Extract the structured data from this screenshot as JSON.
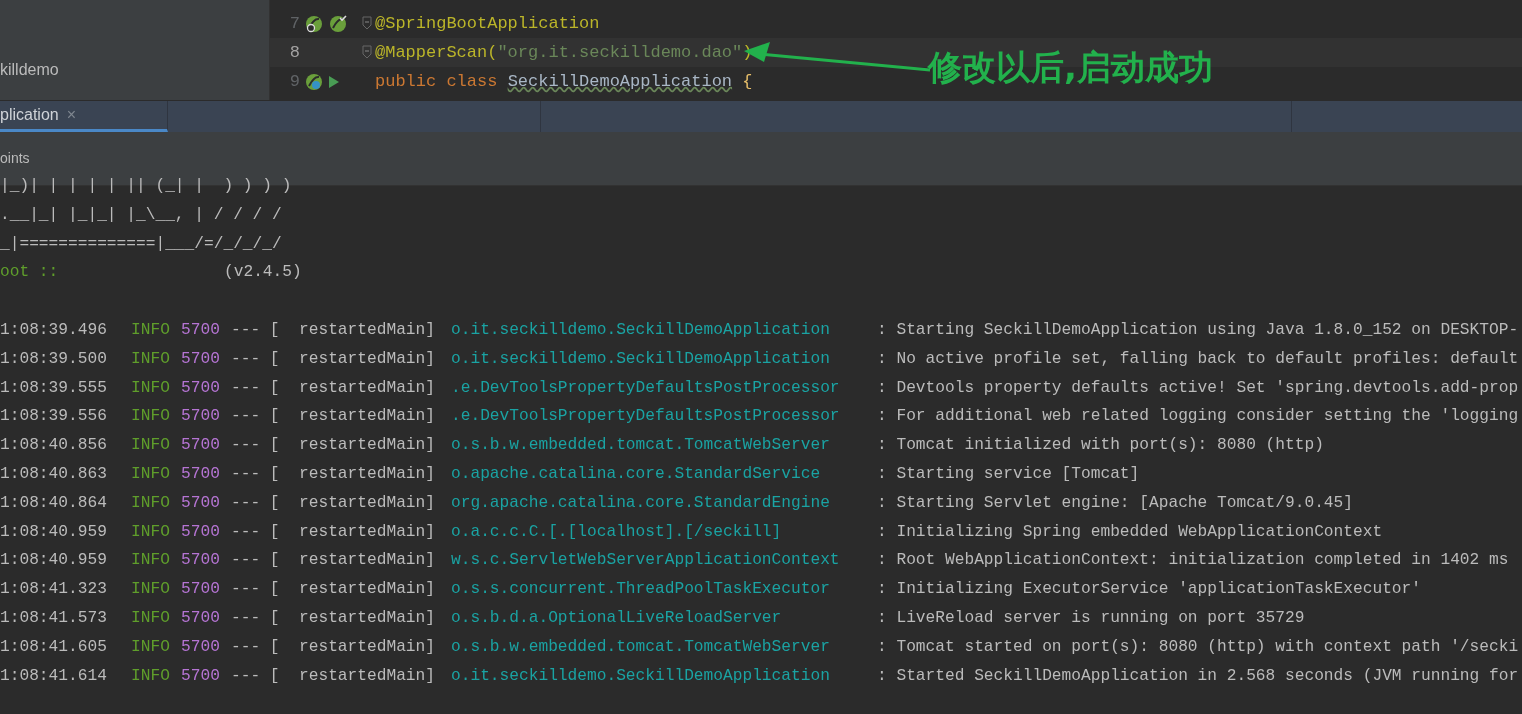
{
  "project_panel": {
    "item": "killdemo"
  },
  "editor": {
    "lines": [
      {
        "number": "7",
        "current": false,
        "kind": "bean",
        "fold": true,
        "tokens": [
          {
            "kind": "annotation",
            "text": "@SpringBootApplication"
          }
        ]
      },
      {
        "number": "8",
        "current": true,
        "kind": "plain",
        "fold": true,
        "tokens": [
          {
            "kind": "annotation",
            "text": "@MapperScan("
          },
          {
            "kind": "string",
            "text": "\"org.it.seckilldemo.dao\""
          },
          {
            "kind": "annotation",
            "text": ")"
          }
        ]
      },
      {
        "number": "9",
        "current": false,
        "kind": "run",
        "fold": false,
        "tokens": [
          {
            "kind": "keyword",
            "text": "public class "
          },
          {
            "kind": "typo",
            "text": "SeckillDemoApplication"
          },
          {
            "kind": "brace",
            "text": " {"
          }
        ]
      }
    ]
  },
  "annotation": {
    "text": "修改以后,启动成功"
  },
  "run_tabs": [
    {
      "label": "plication",
      "selected": true,
      "close": "×"
    }
  ],
  "toolbar": {
    "label": "oints"
  },
  "console": {
    "banner": [
      {
        "kind": "art",
        "text": "|_)| | | | | || (_| |  ) ) ) )"
      },
      {
        "kind": "art",
        "text": ".__|_| |_|_| |_\\__, | / / / /"
      },
      {
        "kind": "art",
        "text": "_|==============|___/=/_/_/_/"
      },
      {
        "kind": "boot",
        "text": "oot ::",
        "version": "(v2.4.5)"
      }
    ],
    "rows": [
      {
        "time": "1:08:39.496",
        "level": "INFO",
        "pid": "5700",
        "thread": "--- [  restartedMain]",
        "logger": "o.it.seckilldemo.SeckillDemoApplication",
        "message": ": Starting SeckillDemoApplication using Java 1.8.0_152 on DESKTOP-"
      },
      {
        "time": "1:08:39.500",
        "level": "INFO",
        "pid": "5700",
        "thread": "--- [  restartedMain]",
        "logger": "o.it.seckilldemo.SeckillDemoApplication",
        "message": ": No active profile set, falling back to default profiles: default"
      },
      {
        "time": "1:08:39.555",
        "level": "INFO",
        "pid": "5700",
        "thread": "--- [  restartedMain]",
        "logger": ".e.DevToolsPropertyDefaultsPostProcessor",
        "message": ": Devtools property defaults active! Set 'spring.devtools.add-prop"
      },
      {
        "time": "1:08:39.556",
        "level": "INFO",
        "pid": "5700",
        "thread": "--- [  restartedMain]",
        "logger": ".e.DevToolsPropertyDefaultsPostProcessor",
        "message": ": For additional web related logging consider setting the 'logging"
      },
      {
        "time": "1:08:40.856",
        "level": "INFO",
        "pid": "5700",
        "thread": "--- [  restartedMain]",
        "logger": "o.s.b.w.embedded.tomcat.TomcatWebServer",
        "message": ": Tomcat initialized with port(s): 8080 (http)"
      },
      {
        "time": "1:08:40.863",
        "level": "INFO",
        "pid": "5700",
        "thread": "--- [  restartedMain]",
        "logger": "o.apache.catalina.core.StandardService",
        "message": ": Starting service [Tomcat]"
      },
      {
        "time": "1:08:40.864",
        "level": "INFO",
        "pid": "5700",
        "thread": "--- [  restartedMain]",
        "logger": "org.apache.catalina.core.StandardEngine",
        "message": ": Starting Servlet engine: [Apache Tomcat/9.0.45]"
      },
      {
        "time": "1:08:40.959",
        "level": "INFO",
        "pid": "5700",
        "thread": "--- [  restartedMain]",
        "logger": "o.a.c.c.C.[.[localhost].[/seckill]",
        "message": ": Initializing Spring embedded WebApplicationContext"
      },
      {
        "time": "1:08:40.959",
        "level": "INFO",
        "pid": "5700",
        "thread": "--- [  restartedMain]",
        "logger": "w.s.c.ServletWebServerApplicationContext",
        "message": ": Root WebApplicationContext: initialization completed in 1402 ms"
      },
      {
        "time": "1:08:41.323",
        "level": "INFO",
        "pid": "5700",
        "thread": "--- [  restartedMain]",
        "logger": "o.s.s.concurrent.ThreadPoolTaskExecutor",
        "message": ": Initializing ExecutorService 'applicationTaskExecutor'"
      },
      {
        "time": "1:08:41.573",
        "level": "INFO",
        "pid": "5700",
        "thread": "--- [  restartedMain]",
        "logger": "o.s.b.d.a.OptionalLiveReloadServer",
        "message": ": LiveReload server is running on port 35729"
      },
      {
        "time": "1:08:41.605",
        "level": "INFO",
        "pid": "5700",
        "thread": "--- [  restartedMain]",
        "logger": "o.s.b.w.embedded.tomcat.TomcatWebServer",
        "message": ": Tomcat started on port(s): 8080 (http) with context path '/secki"
      },
      {
        "time": "1:08:41.614",
        "level": "INFO",
        "pid": "5700",
        "thread": "--- [  restartedMain]",
        "logger": "o.it.seckilldemo.SeckillDemoApplication",
        "message": ": Started SeckillDemoApplication in 2.568 seconds (JVM running for"
      }
    ]
  }
}
